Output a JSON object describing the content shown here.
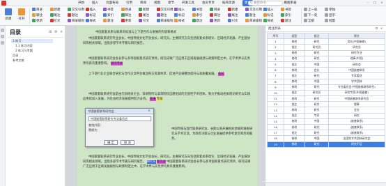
{
  "menu": {
    "items": [
      "开始",
      "插入",
      "页面布局",
      "引用",
      "审阅",
      "视图",
      "章节",
      "开发工具",
      "会员专享",
      "稻壳资源",
      "更多",
      "智能工具箱",
      "看图审查"
    ],
    "active_index": 10,
    "search_placeholder": "Q 查找命令"
  },
  "ribbon": {
    "big_buttons": [
      "新建",
      "打开"
    ],
    "rows": [
      [
        "目录",
        "新建",
        "交叉引用",
        "插入",
        "书签"
      ],
      [
        "脚注",
        "尾注",
        "题注",
        "标记",
        "索引"
      ],
      [
        "更新",
        "引文",
        "目录级别",
        "样式",
        "题注"
      ]
    ],
    "right_buttons": [
      "上一处",
      "下一处",
      "全部",
      "单独",
      "显示",
      "批量"
    ]
  },
  "toc": {
    "title": "目录",
    "items": [
      "1 练习",
      "1.1 练习内容",
      "2 练习与考题",
      "目录",
      "参考文献"
    ]
  },
  "document": {
    "paragraphs": [
      "中国嵌套关系与联系的标准与上下游合作与发展的内容和格式",
      "中国嵌套联系研究专业会长，中国传统文化学会会长，研究员。主要研究方向包括嵌套关系理论、区域经济发展、产业链协同等相关领域，出版多部学术专著与研究报告。",
      "中国嵌套联系研究会会长参与多项国家重点研究项目，研究成果广泛应用于区域发展规划与政策制定之中，在学术界与实务界均具有重要影响。",
      "上下游行业企业联合研究与合作交流平台推动各方资源共享，促进产业链整体提升与高质量发展。",
      "中国嵌套联系研究会是由全国相关企业、科研院所与高等院校自愿组成的全国性学术团体，致力于推动相关理论研究与实践应用的深入发展，为社会经济发展提供智力支持。",
      "中国传统与现代联系研究会，长期以来开展相关领域的调查研究与学术交流，为政府决策与企业发展提供参考意见和咨询服务。"
    ],
    "highlights": [
      "研究员",
      "研究专家",
      "会长",
      "理事",
      "专家",
      "委员会"
    ]
  },
  "dialog": {
    "title": "中国嵌套联系研究会",
    "input_value": "中国嵌套联系研究专业委员会",
    "label1": "查找内容：",
    "label2": "替换为：",
    "ok": "确 定",
    "cancel": "取 消"
  },
  "panel": {
    "title": "批注列表",
    "columns": [
      "序号",
      "类型",
      "批注",
      "原文"
    ],
    "rows": [
      [
        "1",
        "修改",
        "研究",
        "会长(中国嵌套)"
      ],
      [
        "2",
        "批注",
        "研究员",
        "研究员"
      ],
      [
        "3",
        "修改",
        "研究",
        "研究专业"
      ],
      [
        "4",
        "修改",
        "研究",
        "理事(中国)"
      ],
      [
        "5",
        "批注",
        "中国",
        "研究会"
      ],
      [
        "6",
        "修改",
        "会长",
        "中国嵌套联系"
      ],
      [
        "7",
        "批注",
        "研究",
        "专家委员"
      ],
      [
        "8",
        "修改",
        "中国",
        "学术团体"
      ],
      [
        "9",
        "修改",
        "研究",
        "专业委员会(中国嵌套联系研究)"
      ],
      [
        "10",
        "批注",
        "研究员",
        "研究专家(中国嵌套)"
      ],
      [
        "11",
        "修改",
        "研究",
        "中国嵌套联系研究会"
      ],
      [
        "12",
        "批注",
        "研究",
        "理事"
      ],
      [
        "13",
        "修改",
        "研究",
        "会长"
      ],
      [
        "14",
        "批注",
        "专家",
        "研究"
      ],
      [
        "15",
        "修改",
        "中国",
        "(嵌套联系)"
      ],
      [
        "16",
        "修改",
        "研究",
        "(嵌套联系)"
      ],
      [
        "17",
        "批注",
        "研究",
        "(嵌套联系)"
      ],
      [
        "18",
        "修改",
        "中国",
        "全国性学术团体研究会"
      ],
      [
        "19",
        "修改",
        "研究",
        "研究不足"
      ]
    ],
    "selected_row": 18
  }
}
